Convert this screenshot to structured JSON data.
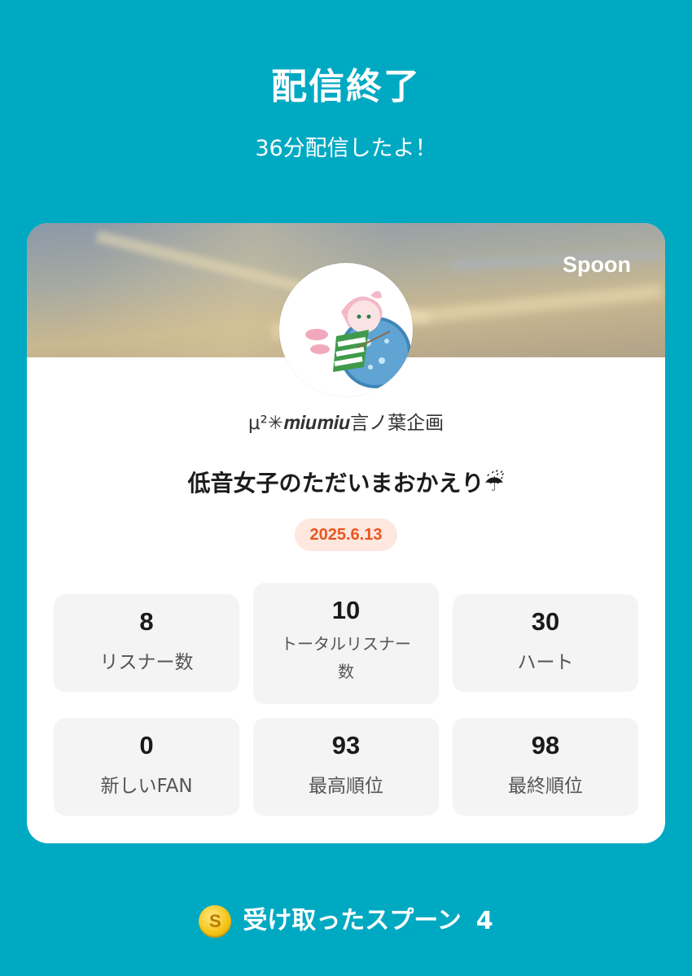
{
  "header": {
    "title": "配信終了",
    "subtitle": "36分配信したよ！"
  },
  "card": {
    "brand": "Spoon",
    "username": "μ²✳︎𝒎𝒊𝒖𝒎𝒊𝒖言ノ葉企画",
    "broadcast_title": "低音女子のただいまおかえり☔",
    "date": "2025.6.13",
    "stats": [
      {
        "value": "8",
        "label": "リスナー数"
      },
      {
        "value": "10",
        "label_line1": "トータルリスナー",
        "label_line2": "数"
      },
      {
        "value": "30",
        "label": "ハート"
      },
      {
        "value": "0",
        "label": "新しいFAN"
      },
      {
        "value": "93",
        "label": "最高順位"
      },
      {
        "value": "98",
        "label": "最終順位"
      }
    ]
  },
  "footer": {
    "coin_icon": "spoon-coin-icon",
    "coin_symbol": "S",
    "spoons_label": "受け取ったスプーン",
    "spoons_count": "4"
  },
  "colors": {
    "background": "#00a9c2",
    "date_text": "#e8571f",
    "date_badge": "#fde7df"
  }
}
